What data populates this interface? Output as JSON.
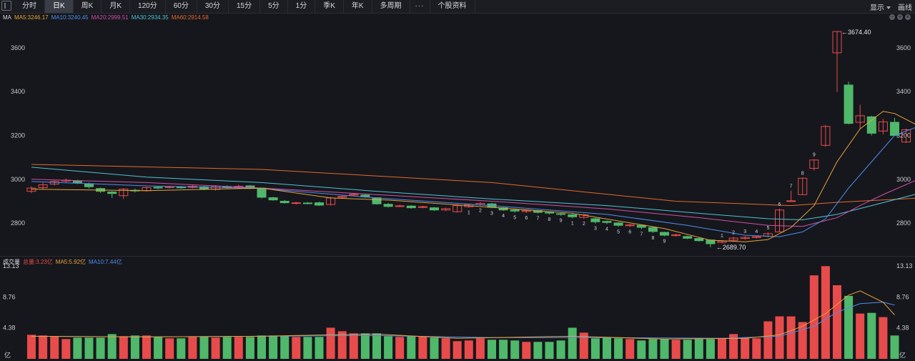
{
  "toolbar": {
    "tabs": [
      "分时",
      "日K",
      "周K",
      "月K",
      "120分",
      "60分",
      "30分",
      "15分",
      "5分",
      "1分",
      "季K",
      "年K",
      "多周期",
      "···",
      "个股资料"
    ],
    "active_tab": 1,
    "display_label": "显示",
    "draw_label": "画线"
  },
  "price_legend": {
    "title": "MA",
    "items": [
      {
        "text": "MA5:3246.17",
        "color": "#e8a33c"
      },
      {
        "text": "MA10:3240.45",
        "color": "#4d8ef0"
      },
      {
        "text": "MA20:2999.51",
        "color": "#d04fa8"
      },
      {
        "text": "MA30:2934.35",
        "color": "#4fc1d6"
      },
      {
        "text": "MA60:2914.58",
        "color": "#e06a2e"
      }
    ]
  },
  "volume_legend": {
    "title": "成交量",
    "items": [
      {
        "text": "总量:3.23亿",
        "color": "#e84b4b"
      },
      {
        "text": "MA5:5.92亿",
        "color": "#e8a33c"
      },
      {
        "text": "MA10:7.44亿",
        "color": "#4d8ef0"
      }
    ]
  },
  "annotations": {
    "high_label": "3674.40",
    "low_label": "2689.70"
  },
  "colors": {
    "up": "#e84b4b",
    "down": "#4fb86a"
  },
  "chart_data": [
    {
      "type": "candlestick",
      "y_ticks": [
        "2800",
        "3000",
        "3200",
        "3400",
        "3600"
      ],
      "ylim": [
        2670,
        3720
      ],
      "seq_numbers": [
        "1",
        "2",
        "3",
        "4",
        "5",
        "6",
        "7",
        "8",
        "9",
        "1",
        "2",
        "3",
        "4",
        "5",
        "6",
        "7",
        "8",
        "9",
        "1",
        "2",
        "3",
        "4",
        "5",
        "6",
        "7",
        "8",
        "9"
      ],
      "candles": [
        [
          2945,
          2960,
          2968,
          2937
        ],
        [
          2962,
          2975,
          2985,
          2955
        ],
        [
          2978,
          2990,
          2995,
          2972
        ],
        [
          2992,
          2996,
          3004,
          2985
        ],
        [
          2993,
          2985,
          2998,
          2978
        ],
        [
          2980,
          2966,
          2985,
          2958
        ],
        [
          2958,
          2945,
          2962,
          2938
        ],
        [
          2942,
          2935,
          2946,
          2915
        ],
        [
          2925,
          2955,
          2960,
          2910
        ],
        [
          2950,
          2947,
          2958,
          2940
        ],
        [
          2948,
          2962,
          2966,
          2944
        ],
        [
          2964,
          2960,
          2968,
          2955
        ],
        [
          2962,
          2966,
          2970,
          2958
        ],
        [
          2965,
          2961,
          2970,
          2957
        ],
        [
          2963,
          2968,
          2974,
          2958
        ],
        [
          2966,
          2955,
          2970,
          2950
        ],
        [
          2954,
          2968,
          2973,
          2948
        ],
        [
          2967,
          2962,
          2972,
          2957
        ],
        [
          2962,
          2968,
          2975,
          2958
        ],
        [
          2970,
          2958,
          2974,
          2955
        ],
        [
          2960,
          2918,
          2962,
          2913
        ],
        [
          2916,
          2906,
          2920,
          2902
        ],
        [
          2900,
          2893,
          2905,
          2889
        ],
        [
          2890,
          2893,
          2897,
          2885
        ],
        [
          2892,
          2890,
          2896,
          2886
        ],
        [
          2893,
          2882,
          2898,
          2878
        ],
        [
          2885,
          2915,
          2920,
          2880
        ],
        [
          2918,
          2922,
          2928,
          2913
        ],
        [
          2928,
          2932,
          2938,
          2924
        ],
        [
          2928,
          2920,
          2933,
          2915
        ],
        [
          2916,
          2888,
          2918,
          2884
        ],
        [
          2886,
          2876,
          2892,
          2871
        ],
        [
          2877,
          2879,
          2884,
          2873
        ],
        [
          2878,
          2870,
          2882,
          2866
        ],
        [
          2872,
          2875,
          2879,
          2868
        ],
        [
          2870,
          2860,
          2874,
          2856
        ],
        [
          2860,
          2866,
          2870,
          2855
        ],
        [
          2852,
          2880,
          2886,
          2848
        ],
        [
          2875,
          2885,
          2890,
          2870
        ],
        [
          2884,
          2890,
          2896,
          2880
        ],
        [
          2888,
          2872,
          2893,
          2868
        ],
        [
          2870,
          2860,
          2873,
          2856
        ],
        [
          2860,
          2855,
          2864,
          2848
        ],
        [
          2853,
          2858,
          2862,
          2846
        ],
        [
          2857,
          2849,
          2860,
          2844
        ],
        [
          2849,
          2846,
          2854,
          2840
        ],
        [
          2843,
          2840,
          2847,
          2834
        ],
        [
          2838,
          2829,
          2842,
          2822
        ],
        [
          2826,
          2838,
          2842,
          2820
        ],
        [
          2820,
          2806,
          2825,
          2798
        ],
        [
          2808,
          2803,
          2812,
          2796
        ],
        [
          2801,
          2790,
          2805,
          2783
        ],
        [
          2788,
          2792,
          2797,
          2782
        ],
        [
          2790,
          2781,
          2794,
          2772
        ],
        [
          2780,
          2762,
          2783,
          2755
        ],
        [
          2758,
          2745,
          2761,
          2740
        ],
        [
          2743,
          2747,
          2752,
          2738
        ],
        [
          2739,
          2731,
          2743,
          2727
        ],
        [
          2730,
          2720,
          2734,
          2716
        ],
        [
          2723,
          2706,
          2726,
          2690
        ],
        [
          2712,
          2718,
          2722,
          2708
        ],
        [
          2722,
          2732,
          2737,
          2715
        ],
        [
          2730,
          2735,
          2741,
          2724
        ],
        [
          2735,
          2738,
          2741,
          2730
        ],
        [
          2740,
          2752,
          2758,
          2735
        ],
        [
          2760,
          2860,
          2866,
          2758
        ],
        [
          2902,
          2902,
          2948,
          2900
        ],
        [
          2930,
          3005,
          3008,
          2928
        ],
        [
          3050,
          3088,
          3092,
          3040
        ],
        [
          3155,
          3241,
          3248,
          3148
        ],
        [
          3577,
          3674,
          3674,
          3398
        ],
        [
          3430,
          3255,
          3445,
          3250
        ],
        [
          3260,
          3290,
          3340,
          3230
        ],
        [
          3285,
          3210,
          3290,
          3200
        ],
        [
          3220,
          3262,
          3275,
          3205
        ],
        [
          3260,
          3200,
          3280,
          3198
        ],
        [
          3170,
          3226,
          3232,
          3166
        ]
      ],
      "ma5": [
        [
          0,
          2955
        ],
        [
          10,
          2948
        ],
        [
          20,
          2960
        ],
        [
          26,
          2915
        ],
        [
          31,
          2905
        ],
        [
          40,
          2872
        ],
        [
          47,
          2845
        ],
        [
          55,
          2775
        ],
        [
          59,
          2722
        ],
        [
          62,
          2715
        ],
        [
          64,
          2725
        ],
        [
          66,
          2780
        ],
        [
          68,
          2880
        ],
        [
          70,
          3080
        ],
        [
          72,
          3230
        ],
        [
          74,
          3310
        ],
        [
          75,
          3300
        ],
        [
          77,
          3246
        ]
      ],
      "ma10": [
        [
          0,
          2990
        ],
        [
          10,
          2970
        ],
        [
          20,
          2958
        ],
        [
          30,
          2915
        ],
        [
          40,
          2880
        ],
        [
          50,
          2840
        ],
        [
          57,
          2790
        ],
        [
          62,
          2745
        ],
        [
          65,
          2738
        ],
        [
          67,
          2760
        ],
        [
          69,
          2820
        ],
        [
          71,
          2960
        ],
        [
          73,
          3080
        ],
        [
          75,
          3200
        ],
        [
          77,
          3240
        ]
      ],
      "ma20": [
        [
          0,
          3000
        ],
        [
          10,
          2985
        ],
        [
          20,
          2960
        ],
        [
          30,
          2930
        ],
        [
          40,
          2900
        ],
        [
          50,
          2865
        ],
        [
          58,
          2825
        ],
        [
          64,
          2790
        ],
        [
          67,
          2785
        ],
        [
          70,
          2825
        ],
        [
          72,
          2880
        ],
        [
          74,
          2930
        ],
        [
          77,
          2999
        ]
      ],
      "ma30": [
        [
          0,
          3055
        ],
        [
          10,
          3010
        ],
        [
          20,
          2985
        ],
        [
          30,
          2945
        ],
        [
          40,
          2910
        ],
        [
          50,
          2880
        ],
        [
          58,
          2845
        ],
        [
          64,
          2820
        ],
        [
          67,
          2815
        ],
        [
          70,
          2840
        ],
        [
          73,
          2880
        ],
        [
          77,
          2934
        ]
      ],
      "ma60": [
        [
          0,
          3068
        ],
        [
          20,
          3045
        ],
        [
          40,
          2985
        ],
        [
          56,
          2900
        ],
        [
          66,
          2880
        ],
        [
          70,
          2895
        ],
        [
          77,
          2914
        ]
      ]
    },
    {
      "type": "bar",
      "y_ticks": [
        "13.13",
        "8.76",
        "4.38"
      ],
      "unit_label": "亿",
      "ylim": [
        0,
        13.13
      ],
      "volumes": [
        3.4,
        3.3,
        3.2,
        2.8,
        3.0,
        3.0,
        3.0,
        3.5,
        3.2,
        3.3,
        3.3,
        3.1,
        2.9,
        2.9,
        3.1,
        3.1,
        3.0,
        3.1,
        3.1,
        3.1,
        3.3,
        3.3,
        3.2,
        3.1,
        3.1,
        3.1,
        4.4,
        3.9,
        3.6,
        3.6,
        3.6,
        3.2,
        3.1,
        3.2,
        3.2,
        3.0,
        2.9,
        2.5,
        2.6,
        2.9,
        2.7,
        2.7,
        2.6,
        2.4,
        2.4,
        2.4,
        2.6,
        4.4,
        3.7,
        2.9,
        3.0,
        2.9,
        2.8,
        2.6,
        2.8,
        2.8,
        2.7,
        2.7,
        2.8,
        2.8,
        2.9,
        3.5,
        3.0,
        2.9,
        5.3,
        6.0,
        6.0,
        5.2,
        11.8,
        13.1,
        10.4,
        8.9,
        6.4,
        6.5,
        5.9,
        3.3
      ],
      "ma5": [
        [
          0,
          3.2
        ],
        [
          10,
          3.1
        ],
        [
          20,
          3.2
        ],
        [
          26,
          3.4
        ],
        [
          30,
          3.5
        ],
        [
          37,
          2.9
        ],
        [
          47,
          3.2
        ],
        [
          55,
          2.8
        ],
        [
          62,
          2.9
        ],
        [
          65,
          3.4
        ],
        [
          67,
          4.6
        ],
        [
          69,
          6.4
        ],
        [
          71,
          9.0
        ],
        [
          72,
          9.6
        ],
        [
          74,
          8.0
        ],
        [
          75,
          6.2
        ]
      ],
      "ma10": [
        [
          0,
          3.2
        ],
        [
          10,
          3.1
        ],
        [
          20,
          3.2
        ],
        [
          30,
          3.3
        ],
        [
          40,
          3.0
        ],
        [
          50,
          3.0
        ],
        [
          60,
          2.9
        ],
        [
          65,
          3.2
        ],
        [
          68,
          4.6
        ],
        [
          70,
          6.6
        ],
        [
          72,
          7.8
        ],
        [
          74,
          8.0
        ],
        [
          75,
          7.6
        ]
      ]
    }
  ]
}
